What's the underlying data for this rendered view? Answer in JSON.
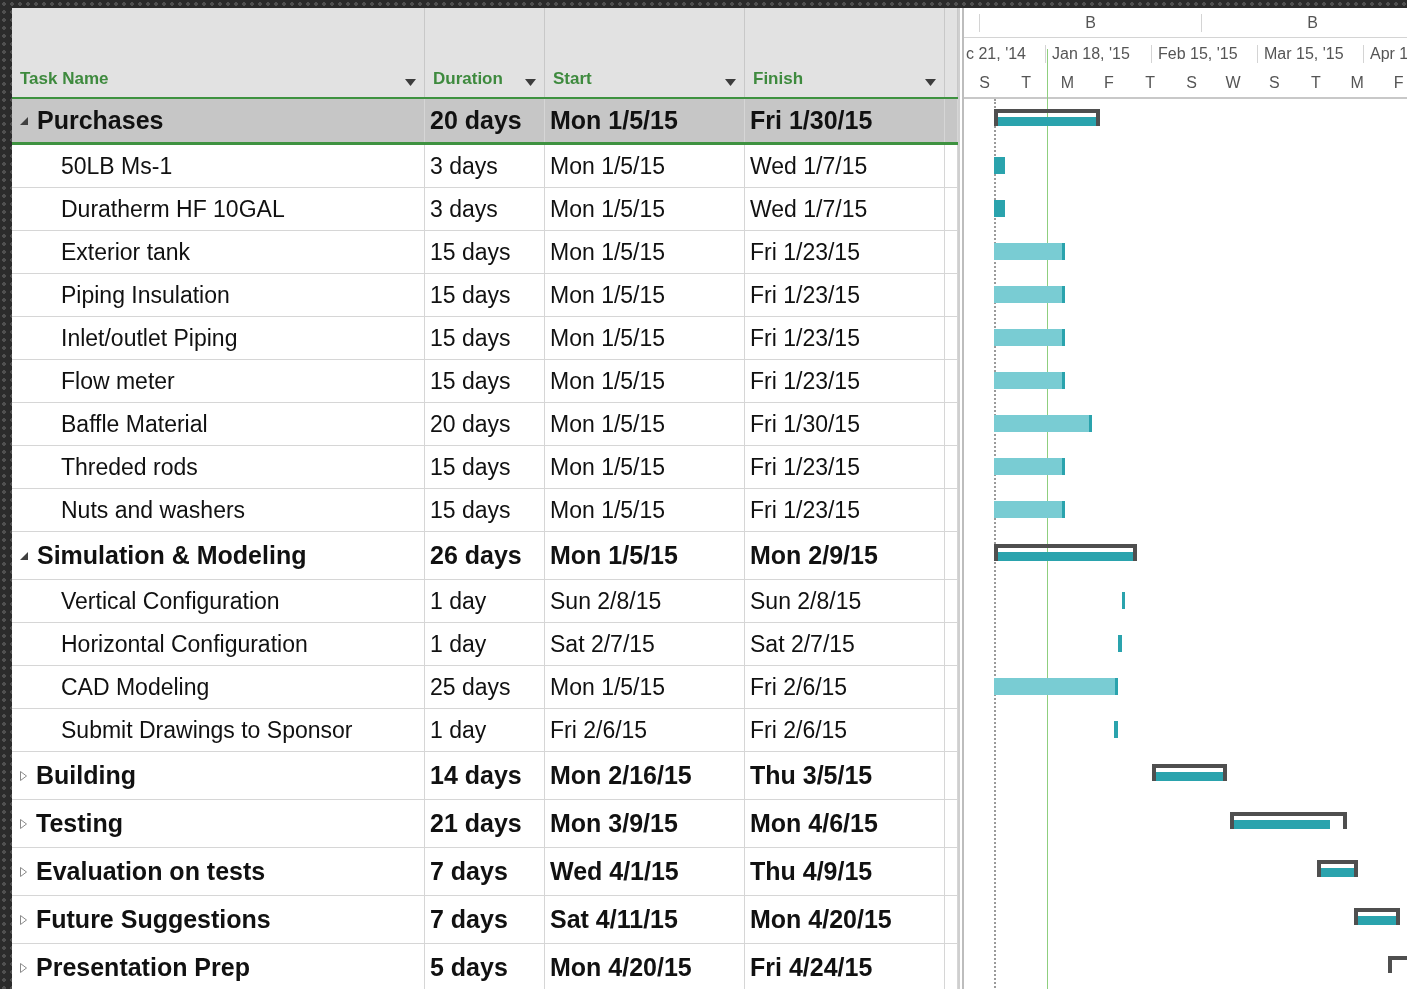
{
  "columns": [
    {
      "label": "Task Name"
    },
    {
      "label": "Duration"
    },
    {
      "label": "Start"
    },
    {
      "label": "Finish"
    }
  ],
  "timescale": {
    "top_tier": [
      "B",
      "B"
    ],
    "middle_tier": [
      "c 21, '14",
      "Jan 18, '15",
      "Feb 15, '15",
      "Mar 15, '15",
      "Apr 1"
    ],
    "bottom_tier": [
      "S",
      "T",
      "M",
      "F",
      "T",
      "S",
      "W",
      "S",
      "T",
      "M",
      "F"
    ]
  },
  "tasks": [
    {
      "name": "Purchases",
      "duration": "20 days",
      "start": "Mon 1/5/15",
      "finish": "Fri 1/30/15",
      "kind": "summary",
      "expanded": true,
      "selected": true,
      "level": 1,
      "children": [
        {
          "name": "50LB Ms-1",
          "duration": "3 days",
          "start": "Mon 1/5/15",
          "finish": "Wed 1/7/15",
          "kind": "task",
          "selected": false,
          "level": 1
        },
        {
          "name": "Duratherm HF 10GAL",
          "duration": "3 days",
          "start": "Mon 1/5/15",
          "finish": "Wed 1/7/15",
          "kind": "task",
          "selected": false,
          "level": 1
        },
        {
          "name": "Exterior tank",
          "duration": "15 days",
          "start": "Mon 1/5/15",
          "finish": "Fri 1/23/15",
          "kind": "task",
          "selected": false
        },
        {
          "name": "Piping Insulation",
          "duration": "15 days",
          "start": "Mon 1/5/15",
          "finish": "Fri 1/23/15",
          "kind": "task",
          "selected": false
        },
        {
          "name": "Inlet/outlet Piping",
          "duration": "15 days",
          "start": "Mon 1/5/15",
          "finish": "Fri 1/23/15",
          "kind": "task",
          "selected": false
        },
        {
          "name": "Flow meter",
          "duration": "15 days",
          "start": "Mon 1/5/15",
          "finish": "Fri 1/23/15",
          "kind": "task",
          "selected": false
        },
        {
          "name": "Baffle Material",
          "duration": "20 days",
          "start": "Mon 1/5/15",
          "finish": "Fri 1/30/15",
          "kind": "task",
          "selected": false
        },
        {
          "name": "Threded rods",
          "duration": "15 days",
          "start": "Mon 1/5/15",
          "finish": "Fri 1/23/15",
          "kind": "task",
          "selected": false
        },
        {
          "name": "Nuts and washers",
          "duration": "15 days",
          "start": "Mon 1/5/15",
          "finish": "Fri 1/23/15",
          "kind": "task",
          "selected": false
        }
      ]
    },
    {
      "name": "Simulation & Modeling",
      "duration": "26 days",
      "start": "Mon 1/5/15",
      "finish": "Mon 2/9/15",
      "kind": "summary",
      "expanded": true,
      "selected": false,
      "level": 1,
      "children": [
        {
          "name": "Vertical Configuration",
          "duration": "1 day",
          "start": "Sun 2/8/15",
          "finish": "Sun 2/8/15",
          "kind": "task",
          "selected": false,
          "level": 1
        },
        {
          "name": "Horizontal Configuration",
          "duration": "1 day",
          "start": "Sat 2/7/15",
          "finish": "Sat 2/7/15",
          "kind": "task",
          "selected": false,
          "level": 1
        },
        {
          "name": "CAD Modeling",
          "duration": "25 days",
          "start": "Mon 1/5/15",
          "finish": "Fri 2/6/15",
          "kind": "task",
          "selected": false
        },
        {
          "name": "Submit Drawings to Sponsor",
          "duration": "1 day",
          "start": "Fri 2/6/15",
          "finish": "Fri 2/6/15",
          "kind": "task",
          "selected": false,
          "level": 1
        }
      ]
    },
    {
      "name": "Building",
      "duration": "14 days",
      "start": "Mon 2/16/15",
      "finish": "Thu 3/5/15",
      "kind": "summary",
      "expanded": false,
      "selected": false,
      "level": 1
    },
    {
      "name": "Testing",
      "duration": "21 days",
      "start": "Mon 3/9/15",
      "finish": "Mon 4/6/15",
      "kind": "summary",
      "expanded": false,
      "selected": false,
      "level": 0.88
    },
    {
      "name": "Evaluation on tests",
      "duration": "7 days",
      "start": "Wed 4/1/15",
      "finish": "Thu 4/9/15",
      "kind": "summary",
      "expanded": false,
      "selected": false,
      "level": 1
    },
    {
      "name": "Future Suggestions",
      "duration": "7 days",
      "start": "Sat 4/11/15",
      "finish": "Mon 4/20/15",
      "kind": "summary",
      "expanded": false,
      "selected": false,
      "level": 1
    },
    {
      "name": "Presentation Prep",
      "duration": "5 days",
      "start": "Mon 4/20/15",
      "finish": "Fri 4/24/15",
      "kind": "summary",
      "expanded": false,
      "selected": false
    }
  ]
}
